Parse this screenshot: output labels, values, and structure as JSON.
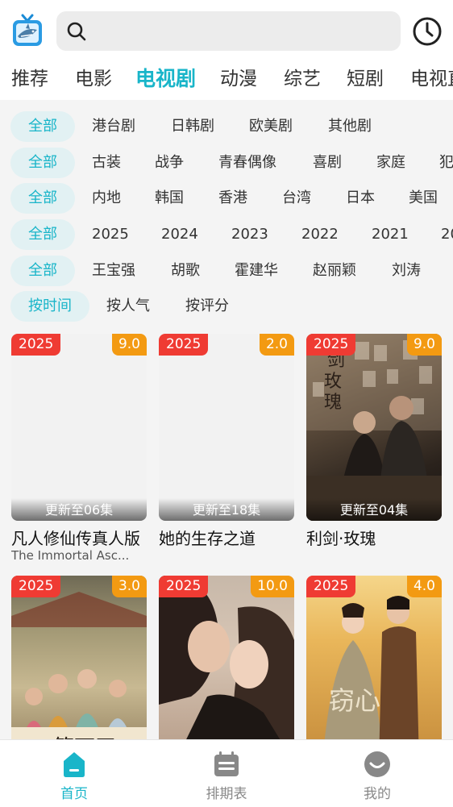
{
  "search": {
    "placeholder": ""
  },
  "tabs": [
    "推荐",
    "电影",
    "电视剧",
    "动漫",
    "综艺",
    "短剧",
    "电视直"
  ],
  "filters": [
    [
      "全部",
      "港台剧",
      "日韩剧",
      "欧美剧",
      "其他剧"
    ],
    [
      "全部",
      "古装",
      "战争",
      "青春偶像",
      "喜剧",
      "家庭",
      "犯"
    ],
    [
      "全部",
      "内地",
      "韩国",
      "香港",
      "台湾",
      "日本",
      "美国"
    ],
    [
      "全部",
      "2025",
      "2024",
      "2023",
      "2022",
      "2021",
      "20"
    ],
    [
      "全部",
      "王宝强",
      "胡歌",
      "霍建华",
      "赵丽颖",
      "刘涛"
    ],
    [
      "按时间",
      "按人气",
      "按评分"
    ]
  ],
  "cards": [
    {
      "year": "2025",
      "score": "9.0",
      "update": "更新至06集",
      "title": "凡人修仙传真人版",
      "subtitle": "The Immortal Asc..."
    },
    {
      "year": "2025",
      "score": "2.0",
      "update": "更新至18集",
      "title": "她的生存之道",
      "subtitle": ""
    },
    {
      "year": "2025",
      "score": "9.0",
      "update": "更新至04集",
      "title": "利剑·玫瑰",
      "subtitle": ""
    },
    {
      "year": "2025",
      "score": "3.0",
      "update": "",
      "title": "",
      "subtitle": ""
    },
    {
      "year": "2025",
      "score": "10.0",
      "update": "",
      "title": "",
      "subtitle": ""
    },
    {
      "year": "2025",
      "score": "4.0",
      "update": "",
      "title": "",
      "subtitle": ""
    }
  ],
  "nav": {
    "home": "首页",
    "schedule": "排期表",
    "mine": "我的"
  },
  "colors": {
    "accent": "#19b5c9",
    "year_badge": "#ef3b33",
    "score_badge": "#f39a12"
  },
  "icons": {
    "logo": "shark-tv-logo",
    "search": "search-icon",
    "history": "clock-icon",
    "home": "home-icon",
    "schedule": "calendar-icon",
    "mine": "smile-face-icon"
  }
}
